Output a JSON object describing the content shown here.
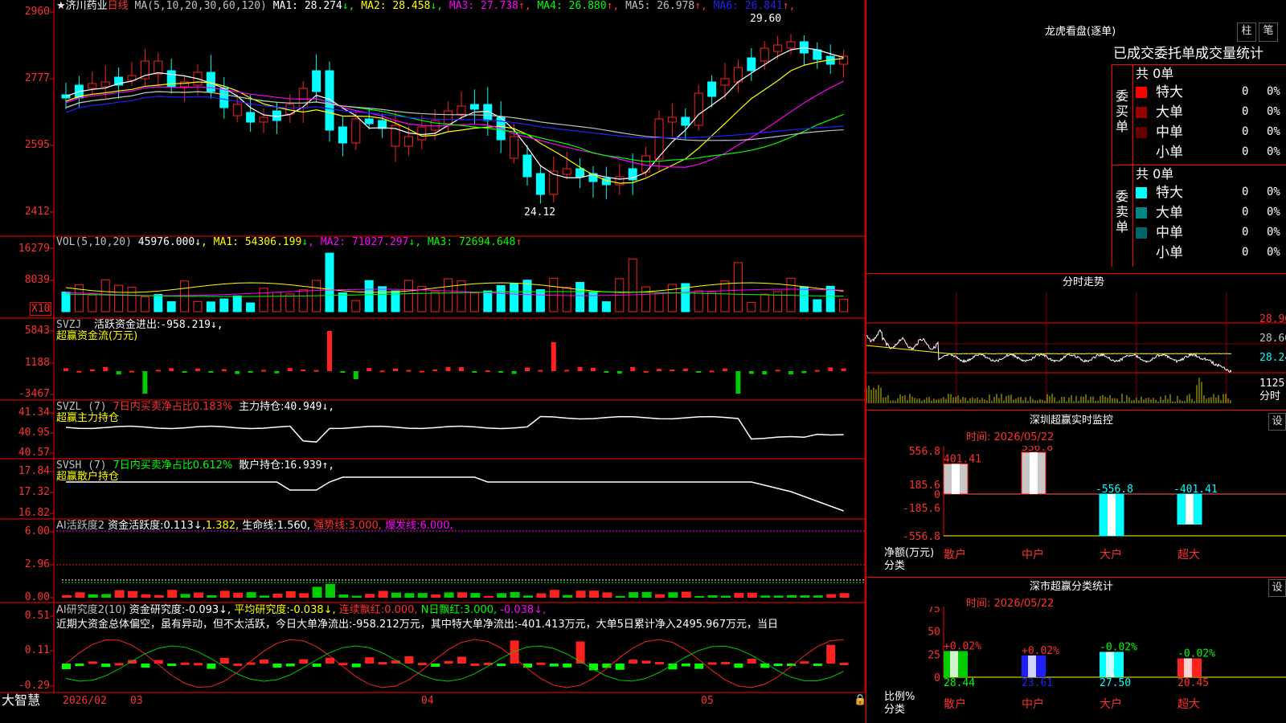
{
  "colors": {
    "up": "#ff2020",
    "down": "#00ffff",
    "grid": "#ff0000",
    "ma1": "#ffffff",
    "ma2": "#ffff00",
    "ma3": "#ff00ff",
    "ma4": "#00ff00",
    "ma5": "#c0c0c0",
    "ma6": "#2020ff"
  },
  "main": {
    "stock_name": "★济川药业",
    "period": "日线",
    "ma_label": "MA(5,10,20,30,60,120)",
    "ma": [
      {
        "label": "MA1:",
        "value": "28.274",
        "arrow": "↓",
        "color": "#ffffff"
      },
      {
        "label": "MA2:",
        "value": "28.458",
        "arrow": "↓",
        "color": "#ffff00"
      },
      {
        "label": "MA3:",
        "value": "27.738",
        "arrow": "↑",
        "color": "#ff00ff"
      },
      {
        "label": "MA4:",
        "value": "26.880",
        "arrow": "↑",
        "color": "#00ff00"
      },
      {
        "label": "MA5:",
        "value": "26.978",
        "arrow": "↑",
        "color": "#c0c0c0"
      },
      {
        "label": "MA6:",
        "value": "26.841",
        "arrow": "↑",
        "color": "#2020ff"
      }
    ],
    "yticks": [
      "2960",
      "2777",
      "2595",
      "2412"
    ],
    "high_marker": "29.60",
    "low_marker": "24.12"
  },
  "vol": {
    "label": "VOL(5,10,20)",
    "value": "45976.000",
    "arrow": "↓",
    "ma": [
      {
        "label": "MA1:",
        "value": "54306.199",
        "arrow": "↓",
        "color": "#ffff00"
      },
      {
        "label": "MA2:",
        "value": "71027.297",
        "arrow": "↓",
        "color": "#ff00ff"
      },
      {
        "label": "MA3:",
        "value": "72694.648",
        "arrow": "↑",
        "color": "#00ff00"
      }
    ],
    "yticks": [
      "16279",
      "8039"
    ],
    "unit": "X10"
  },
  "svzj": {
    "label": "SVZJ",
    "text": "活跃资金进出:",
    "value": "-958.219",
    "arrow": "↓,",
    "subtitle": "超赢资金流(万元)",
    "yticks": [
      "5843",
      "1188",
      "-3467"
    ]
  },
  "svzl": {
    "label": "SVZL (7)",
    "text1": "7日内买卖净占比0.183%",
    "text2": "主力持仓:",
    "value": "40.949",
    "arrow": "↓,",
    "subtitle": "超赢主力持仓",
    "yticks": [
      "41.34",
      "40.95",
      "40.57"
    ]
  },
  "svsh": {
    "label": "SVSH (7)",
    "text1": "7日内买卖净占比0.612%",
    "text2": "散户持仓:",
    "value": "16.939",
    "arrow": "↑,",
    "subtitle": "超赢散户持仓",
    "yticks": [
      "17.84",
      "17.32",
      "16.82"
    ]
  },
  "ai1": {
    "label": "AI活跃度2",
    "t1": "资金活跃度:",
    "v1": "0.113",
    "a1": "↓,",
    "v2": "1.382,",
    "t3": "生命线:",
    "v3": "1.560,",
    "t4": "强势线:",
    "v4": "3.000,",
    "t5": "爆发线:",
    "v5": "6.000,",
    "yticks": [
      "6.00",
      "2.96",
      "0.00"
    ]
  },
  "ai2": {
    "label": "AI研究度2(10)",
    "t1": "资金研究度:",
    "v1": "-0.093",
    "a1": "↓,",
    "t2": "平均研究度:",
    "v2": "-0.038",
    "a2": "↓,",
    "t3": "连续飘红:",
    "v3": "0.000,",
    "t4": "N日飘红:",
    "v4": "3.000,",
    "t5": "-0.038",
    "a5": "↓,",
    "comment": "近期大资金总体偏空，虽有异动，但不太活跃，今日大单净流出:-958.212万元，其中特大单净流出:-401.413万元，大单5日累计净入2495.967万元，当日",
    "yticks": [
      "0.51",
      "0.11",
      "-0.29"
    ]
  },
  "xaxis": {
    "logo": "大智慧",
    "labels": [
      "2026/02",
      "03",
      "04",
      "05"
    ]
  },
  "lhb": {
    "title": "龙虎看盘(逐单)",
    "btn1": "柱",
    "btn2": "笔",
    "header": "已成交委托单成交量统计",
    "buy": {
      "side": "委买单",
      "count": "共 0单",
      "rows": [
        {
          "name": "特大",
          "color": "#ff0000",
          "v": "0",
          "p": "0%"
        },
        {
          "name": "大单",
          "color": "#990000",
          "v": "0",
          "p": "0%"
        },
        {
          "name": "中单",
          "color": "#660000",
          "v": "0",
          "p": "0%"
        },
        {
          "name": "小单",
          "color": "#000000",
          "v": "0",
          "p": "0%"
        }
      ]
    },
    "sell": {
      "side": "委卖单",
      "count": "共 0单",
      "rows": [
        {
          "name": "特大",
          "color": "#00ffff",
          "v": "0",
          "p": "0%"
        },
        {
          "name": "大单",
          "color": "#008888",
          "v": "0",
          "p": "0%"
        },
        {
          "name": "中单",
          "color": "#006666",
          "v": "0",
          "p": "0%"
        },
        {
          "name": "小单",
          "color": "#000000",
          "v": "0",
          "p": "0%"
        }
      ]
    }
  },
  "intraday": {
    "title": "分时走势",
    "yticks": [
      "28.96",
      "28.60",
      "28.24"
    ],
    "vol_tick": "1125",
    "foot": "分时"
  },
  "monitor": {
    "title": "深圳超赢实时监控",
    "btn": "设",
    "time": "时间: 2026/05/22",
    "yticks": [
      "556.8",
      "185.6",
      "0",
      "-185.6",
      "-556.8"
    ],
    "ylabel": "净额(万元)",
    "xlabel": "分类",
    "bars": [
      {
        "name": "散户",
        "value": 401.41,
        "label": "401.41"
      },
      {
        "name": "中户",
        "value": 556.8,
        "label": "556.8"
      },
      {
        "name": "大户",
        "value": -556.8,
        "label": "-556.8"
      },
      {
        "name": "超大",
        "value": -401.41,
        "label": "-401.41"
      }
    ]
  },
  "classify": {
    "title": "深市超赢分类统计",
    "btn": "设",
    "time": "时间: 2026/05/22",
    "yticks": [
      "75",
      "50",
      "25",
      "0"
    ],
    "ylabel": "比例%",
    "xlabel": "分类",
    "bars": [
      {
        "name": "散户",
        "pct": "+0.02%",
        "value": "28.44",
        "color": "#00cc00",
        "height": 28.44
      },
      {
        "name": "中户",
        "pct": "+0.02%",
        "value": "23.61",
        "color": "#2020ff",
        "height": 23.61
      },
      {
        "name": "大户",
        "pct": "-0.02%",
        "value": "27.50",
        "color": "#00ffff",
        "height": 27.5
      },
      {
        "name": "超大",
        "pct": "-0.02%",
        "value": "20.45",
        "color": "#ff2020",
        "height": 20.45
      }
    ]
  }
}
